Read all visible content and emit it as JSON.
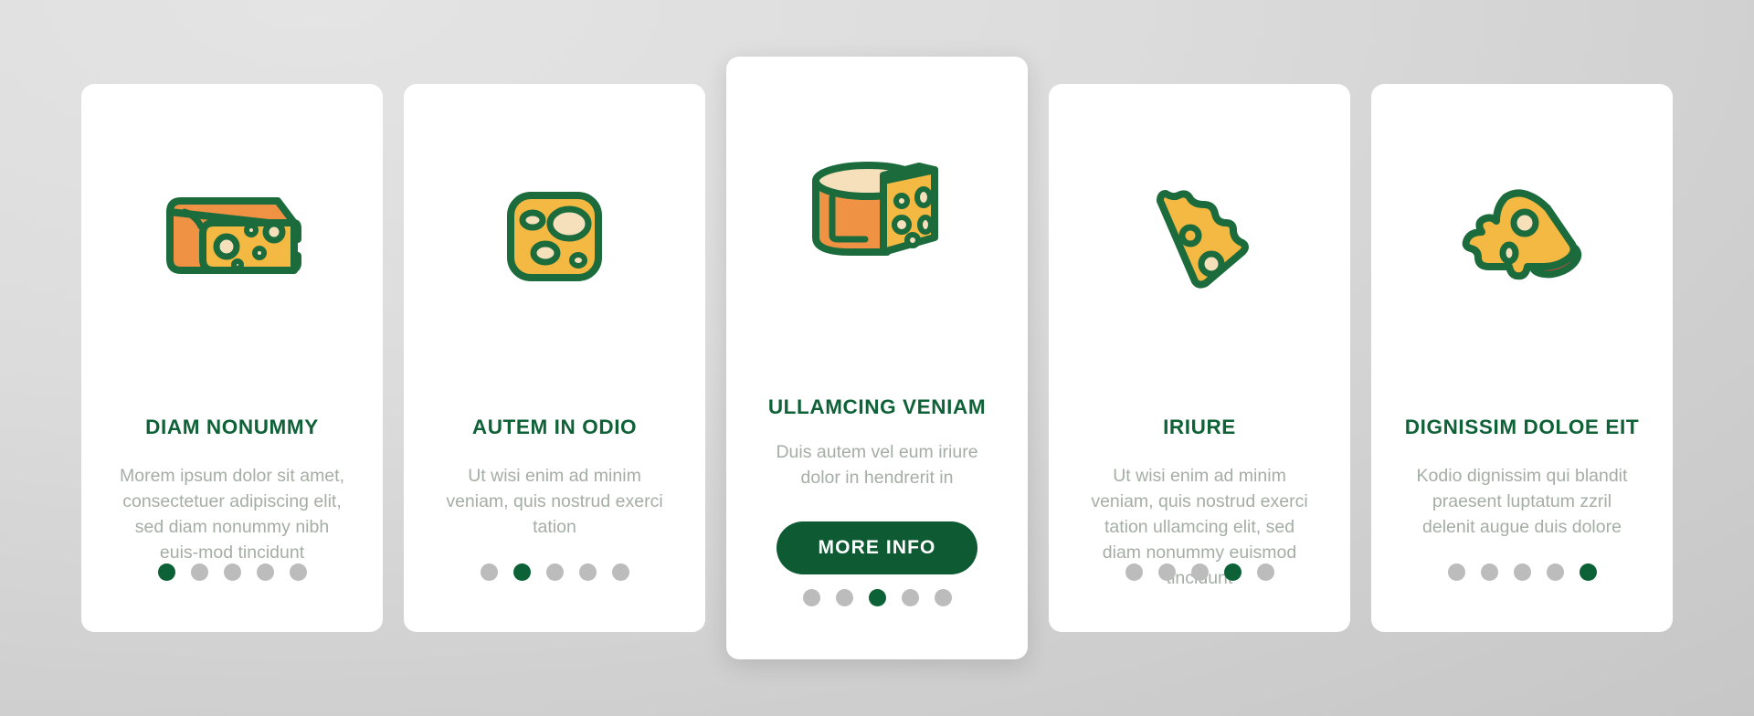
{
  "theme": {
    "background": "#d8d8d8",
    "card_background": "#ffffff",
    "title_color": "#0f6137",
    "body_color": "#a4aea4",
    "accent_green": "#0c6136",
    "dot_inactive": "#bcbcbc",
    "cheese_yellow": "#f4b942",
    "cheese_orange": "#f09243",
    "cheese_outline": "#1c6b3c",
    "hole_cream": "#f5e0bb",
    "salami_red": "#e8463f"
  },
  "cards": [
    {
      "id": "card-1",
      "icon": "cheese-wedge-block-icon",
      "title": "DIAM NONUMMY",
      "body": "Morem ipsum dolor sit amet, consectetuer adipiscing elit, sed diam nonummy nibh euis-mod tincidunt",
      "dots_total": 5,
      "active_dot": 1,
      "has_button": false,
      "featured": false
    },
    {
      "id": "card-2",
      "icon": "cheese-slice-square-icon",
      "title": "AUTEM IN ODIO",
      "body": "Ut wisi enim ad minim veniam, quis nostrud exerci tation",
      "dots_total": 5,
      "active_dot": 2,
      "has_button": false,
      "featured": false
    },
    {
      "id": "card-3",
      "icon": "cheese-wheel-cut-icon",
      "title": "ULLAMCING VENIAM",
      "body": "Duis autem vel eum iriure dolor in hendrerit in",
      "button_label": "MORE INFO",
      "dots_total": 5,
      "active_dot": 3,
      "has_button": true,
      "featured": true
    },
    {
      "id": "card-4",
      "icon": "cheese-triangle-slice-icon",
      "title": "IRIURE",
      "body": "Ut wisi enim ad minim veniam, quis nostrud exerci tation ullamcing elit, sed diam nonummy euismod tincidunt",
      "dots_total": 5,
      "active_dot": 4,
      "has_button": false,
      "featured": false
    },
    {
      "id": "card-5",
      "icon": "melted-cheese-salami-icon",
      "title": "DIGNISSIM DOLOE EIT",
      "body": "Kodio dignissim qui blandit praesent luptatum zzril delenit augue duis dolore",
      "dots_total": 5,
      "active_dot": 5,
      "has_button": false,
      "featured": false
    }
  ]
}
